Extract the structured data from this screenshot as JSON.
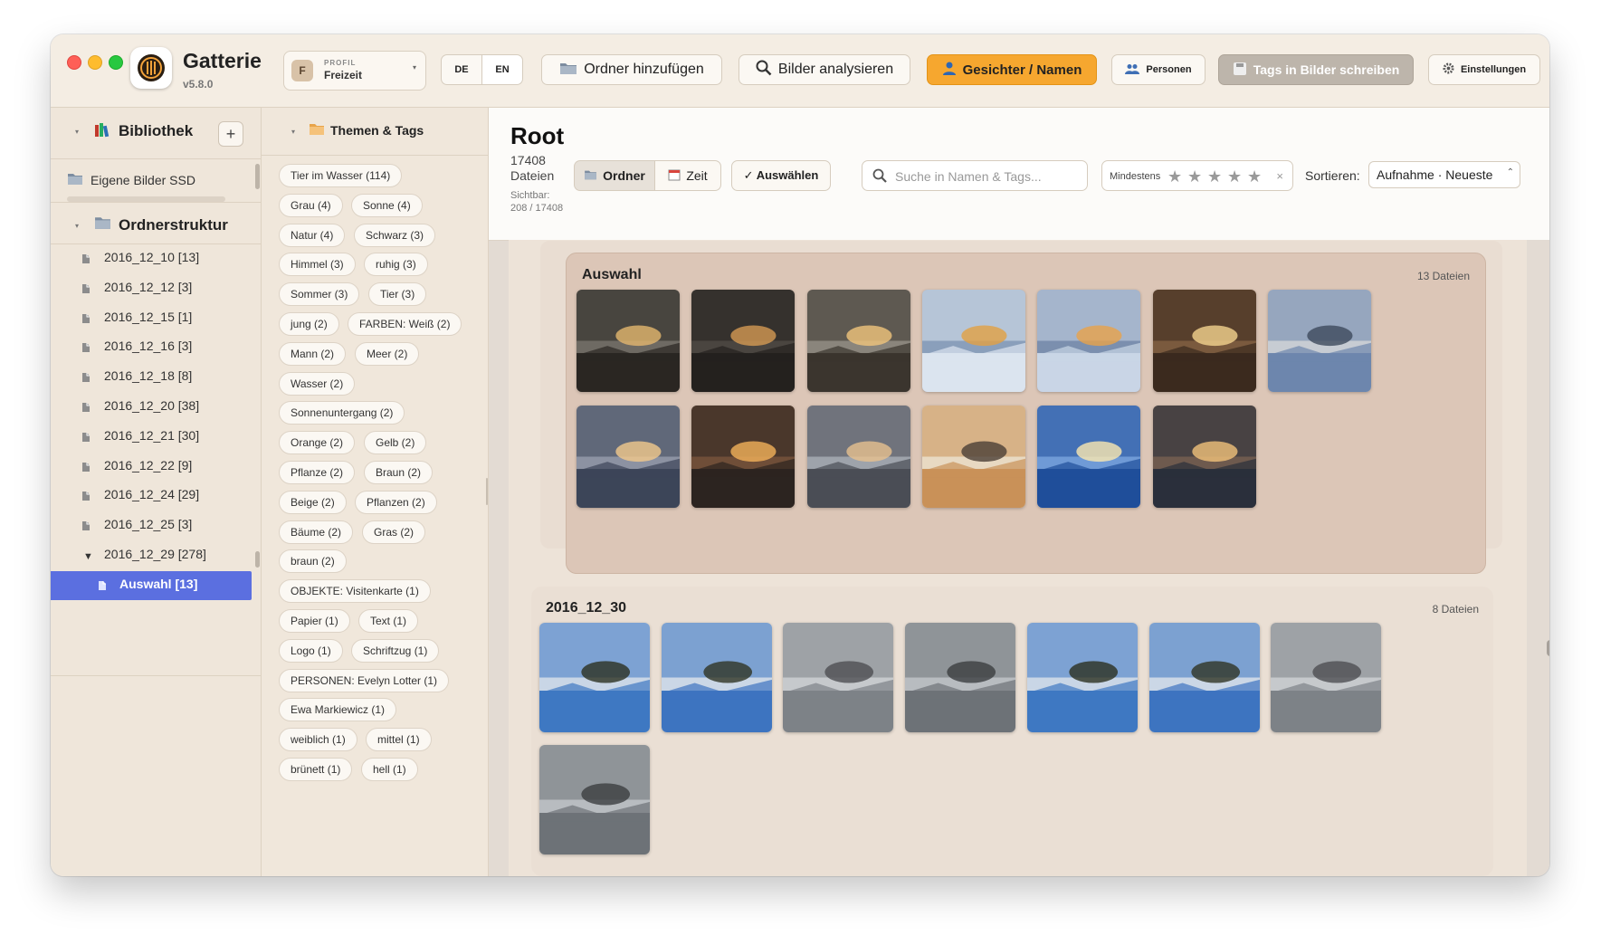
{
  "app": {
    "name": "Gatterie",
    "version": "v5.8.0"
  },
  "profile": {
    "label": "PROFIL",
    "value": "Freizeit",
    "avatar_letter": "F"
  },
  "toolbar": {
    "lang_de": "DE",
    "lang_en": "EN",
    "add_folder": "Ordner hinzufügen",
    "analyze": "Bilder analysieren",
    "faces": "Gesichter / Namen",
    "persons": "Personen",
    "write_tags": "Tags in Bilder schreiben",
    "settings": "Einstellungen",
    "accent_color": "#f6a72f"
  },
  "sidebar": {
    "library_title": "Bibliothek",
    "add_label": "+",
    "source": "Eigene Bilder SSD",
    "folder_title": "Ordnerstruktur",
    "folders": [
      {
        "label": "2016_12_10 [13]"
      },
      {
        "label": "2016_12_12 [3]"
      },
      {
        "label": "2016_12_15 [1]"
      },
      {
        "label": "2016_12_16 [3]"
      },
      {
        "label": "2016_12_18 [8]"
      },
      {
        "label": "2016_12_20 [38]"
      },
      {
        "label": "2016_12_21 [30]"
      },
      {
        "label": "2016_12_22 [9]"
      },
      {
        "label": "2016_12_24 [29]"
      },
      {
        "label": "2016_12_25 [3]"
      },
      {
        "label": "2016_12_29 [278]",
        "expanded": true
      },
      {
        "label": "Auswahl [13]",
        "selected": true
      }
    ],
    "selected_color": "#5b6fe0"
  },
  "tags_panel": {
    "title": "Themen & Tags",
    "tags": [
      "Tier im Wasser (114)",
      "Grau (4)",
      "Sonne (4)",
      "Natur (4)",
      "Schwarz (3)",
      "Himmel (3)",
      "ruhig (3)",
      "Sommer (3)",
      "Tier (3)",
      "jung (2)",
      "FARBEN: Weiß (2)",
      "Mann (2)",
      "Meer (2)",
      "Wasser (2)",
      "Sonnenuntergang (2)",
      "Orange (2)",
      "Gelb (2)",
      "Pflanze (2)",
      "Braun (2)",
      "Beige (2)",
      "Pflanzen (2)",
      "Bäume (2)",
      "Gras (2)",
      "braun (2)",
      "OBJEKTE: Visitenkarte (1)",
      "Papier (1)",
      "Text (1)",
      "Logo (1)",
      "Schriftzug (1)",
      "PERSONEN: Evelyn Lotter (1)",
      "Ewa Markiewicz (1)",
      "weiblich (1)",
      "mittel (1)",
      "brünett (1)",
      "hell (1)"
    ]
  },
  "main": {
    "title": "Root",
    "count": "17408 Dateien",
    "visible": "Sichtbar: 208 / 17408",
    "view_folder": "Ordner",
    "view_time": "Zeit",
    "select": "✓ Auswählen",
    "search_placeholder": "Suche in Namen & Tags...",
    "rating_label": "Mindestens",
    "rating_clear": "×",
    "sort_label": "Sortieren:",
    "sort_value": "Aufnahme · Neueste",
    "groups": [
      {
        "title": "Auswahl",
        "count": "13 Dateien"
      },
      {
        "title": "2016_12_30",
        "count": "8 Dateien"
      }
    ]
  }
}
